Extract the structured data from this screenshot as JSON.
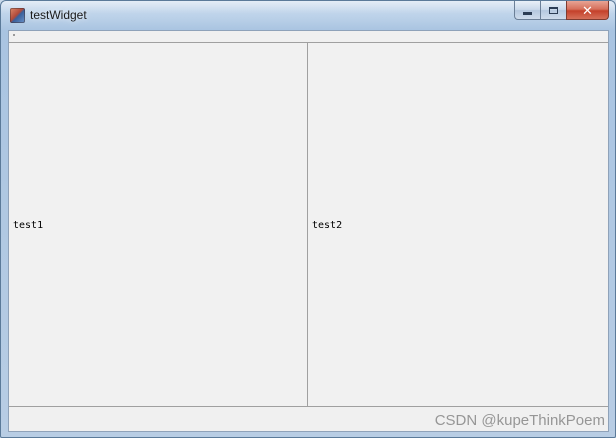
{
  "window": {
    "title": "testWidget",
    "app_icon": "qt-app-icon",
    "buttons": {
      "minimize_icon": "minimize-icon",
      "maximize_icon": "maximize-icon",
      "close_icon": "close-icon",
      "close_glyph": "✕"
    }
  },
  "panes": [
    {
      "label": "test1"
    },
    {
      "label": "test2"
    }
  ],
  "watermark": "CSDN @kupeThinkPoem",
  "colors": {
    "client_bg": "#f0f0f0",
    "close_button": "#c4412a",
    "frame": "#a9c4e1"
  }
}
